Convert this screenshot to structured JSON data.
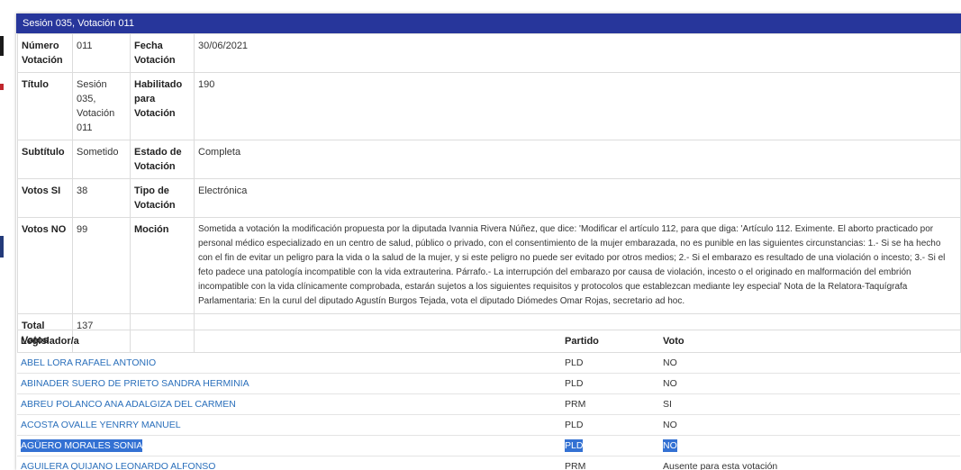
{
  "header": {
    "title": "Sesión 035, Votación 011"
  },
  "info": {
    "numero_votacion_label": "Número Votación",
    "numero_votacion": "011",
    "fecha_label": "Fecha Votación",
    "fecha": "30/06/2021",
    "titulo_label": "Título",
    "titulo": "Sesión 035, Votación 011",
    "habilitado_label": "Habilitado para Votación",
    "habilitado": "190",
    "subtitulo_label": "Subtítulo",
    "subtitulo": "Sometido",
    "estado_label": "Estado de Votación",
    "estado": "Completa",
    "votos_si_label": "Votos SI",
    "votos_si": "38",
    "tipo_label": "Tipo de Votación",
    "tipo": "Electrónica",
    "votos_no_label": "Votos NO",
    "votos_no": "99",
    "mocion_label": "Moción",
    "mocion": "Sometida a votación la modificación propuesta por la diputada Ivannia Rivera Núñez, que dice: 'Modificar el artículo 112, para que diga: 'Artículo 112. Eximente. El aborto practicado por personal médico especializado en un centro de salud, público o privado, con el consentimiento de la mujer embarazada, no es punible en las siguientes circunstancias: 1.- Si se ha hecho con el fin de evitar un peligro para la vida o la salud de la mujer, y si este peligro no puede ser evitado por otros medios; 2.- Si el embarazo es resultado de una violación o incesto; 3.- Si el feto padece una patología incompatible con la vida extrauterina. Párrafo.- La interrupción del embarazo por causa de violación, incesto o el originado en malformación del embrión incompatible con la vida clínicamente comprobada, estarán sujetos a los siguientes requisitos y protocolos que establezcan mediante ley especial' Nota de la Relatora-Taquígrafa Parlamentaria: En la curul del diputado Agustín Burgos Tejada, vota el diputado Diómedes Omar Rojas, secretario ad hoc.",
    "total_votos_label": "Total Votos",
    "total_votos": "137"
  },
  "votes": {
    "columns": [
      "Legislador/a",
      "Partido",
      "Voto"
    ],
    "rows": [
      {
        "name": "ABEL LORA RAFAEL ANTONIO",
        "party": "PLD",
        "vote": "NO"
      },
      {
        "name": "ABINADER SUERO DE PRIETO SANDRA HERMINIA",
        "party": "PLD",
        "vote": "NO"
      },
      {
        "name": "ABREU POLANCO ANA ADALGIZA DEL CARMEN",
        "party": "PRM",
        "vote": "SI"
      },
      {
        "name": "ACOSTA OVALLE YENRRY MANUEL",
        "party": "PLD",
        "vote": "NO"
      },
      {
        "name": "AGÜERO MORALES SONIA",
        "party": "PLD",
        "vote": "NO",
        "highlighted": true
      },
      {
        "name": "AGUILERA QUIJANO LEONARDO ALFONSO",
        "party": "PRM",
        "vote": "Ausente para esta votación"
      }
    ]
  },
  "colors": {
    "header_bg": "#27369b",
    "link": "#2a6fbb",
    "selection": "#3371d3"
  }
}
